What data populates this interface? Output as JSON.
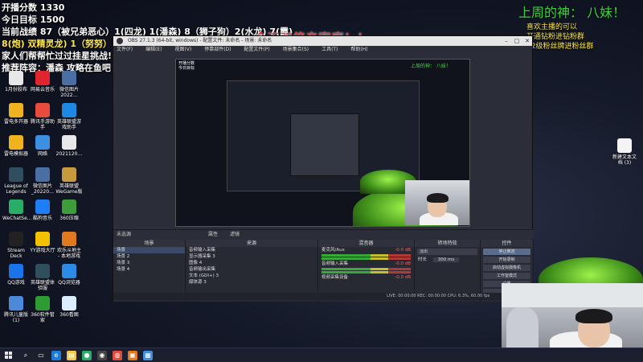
{
  "overlay": {
    "score_label": "开播分数",
    "score_value": "1330",
    "goal_label": "今日目标",
    "goal_value": "1500",
    "record_line": "当前战绩 87（被兄弟恶心）1(四龙) 1(潘森) 8（狮子狗）2(水龙) 7(霞)",
    "record_line2": "8(炮) 双精灵龙) 1（努努）(潘森) 3(凯) 1 (水枪)",
    "help_line": "家人们帮帮忙过过挂星挑战!",
    "lineup_line": "推荐阵容：潘森 攻略在鱼吧",
    "title": "今天双倍亲密度！！",
    "god_title": "上周的神： 八妹！",
    "fan_lines": [
      "喜欢主播的可以",
      "开通钻粉进钻粉群",
      "12级粉丝牌进粉丝群"
    ]
  },
  "desktop_icons_left": [
    {
      "label": "1月份胶布",
      "icon": "document-icon",
      "color": "#e8e8e8"
    },
    {
      "label": "网易云音乐",
      "icon": "netease-music-icon",
      "color": "#e0262c"
    },
    {
      "label": "微信图片 2022…",
      "icon": "image-icon",
      "color": "#4a6fa5"
    },
    {
      "label": "雷电多开器",
      "icon": "android-emulator-icon",
      "color": "#f0b21e"
    },
    {
      "label": "腾讯手游助手",
      "icon": "tencent-games-icon",
      "color": "#e94b3c"
    },
    {
      "label": "英雄联盟游戏助手",
      "icon": "lol-helper-icon",
      "color": "#1e88e5"
    },
    {
      "label": "雷电模拟器",
      "icon": "ldplayer-icon",
      "color": "#f0b21e"
    },
    {
      "label": "网络",
      "icon": "network-icon",
      "color": "#3d8fe0"
    },
    {
      "label": "2021120…",
      "icon": "document-icon",
      "color": "#e8e8e8"
    },
    {
      "label": "League of Legends",
      "icon": "lol-icon",
      "color": "#2f4f5f"
    },
    {
      "label": "微信图片_20220…",
      "icon": "image-icon",
      "color": "#4a6fa5"
    },
    {
      "label": "英雄联盟WeGame版",
      "icon": "wegame-icon",
      "color": "#c79b3b"
    },
    {
      "label": "WeChatSe…",
      "icon": "wechat-icon",
      "color": "#2aae67"
    },
    {
      "label": "酷狗音乐",
      "icon": "kugou-icon",
      "color": "#1f7ef5"
    },
    {
      "label": "360压缩",
      "icon": "archive-icon",
      "color": "#3f9c3a"
    },
    {
      "label": "Stream Deck",
      "icon": "stream-deck-icon",
      "color": "#222"
    },
    {
      "label": "YY游戏大厅",
      "icon": "yy-icon",
      "color": "#f2c200"
    },
    {
      "label": "欢乐斗地主 - 本地游戏",
      "icon": "doudizhu-icon",
      "color": "#e07a1f"
    },
    {
      "label": "QQ游戏",
      "icon": "qq-games-icon",
      "color": "#1a73e8"
    },
    {
      "label": "英雄联盟体验服",
      "icon": "lol-pbe-icon",
      "color": "#2f4f5f"
    },
    {
      "label": "QQ浏览器",
      "icon": "qq-browser-icon",
      "color": "#2b8be6"
    },
    {
      "label": "腾讯儿童版 (1)",
      "icon": "folder-icon",
      "color": "#4c89d9"
    },
    {
      "label": "360软件管家",
      "icon": "360-manager-icon",
      "color": "#2f9b34"
    },
    {
      "label": "360看图",
      "icon": "360-viewer-icon",
      "color": "#dbeeff"
    }
  ],
  "desktop_icons_right": [
    {
      "label": "新建文本文档 (3)",
      "icon": "text-file-icon",
      "color": "#f4f4f4"
    }
  ],
  "obs": {
    "window_title": "OBS 27.1.3 (64-bit, windows) - 配置文件: 未命名 - 场景: 未命名",
    "menu": [
      "文件(F)",
      "编辑(E)",
      "视图(V)",
      "停靠部件(D)",
      "配置文件(P)",
      "场景集合(S)",
      "工具(T)",
      "帮助(H)"
    ],
    "scene_bar_label": "未选源",
    "properties_button": "属性",
    "filters_button": "滤镜",
    "docks": {
      "scenes_title": "场景",
      "scenes": [
        "场景",
        "场景 2",
        "场景 3",
        "场景 4"
      ],
      "sources_title": "来源",
      "sources": [
        "音频输入采集",
        "显示器采集 3",
        "图像 4",
        "音频输出采集",
        "文本 (GDI+) 3",
        "媒体源 3"
      ],
      "mixer_title": "混音器",
      "mixer": [
        {
          "name": "麦克风/Aux",
          "db": "-0.0 dB"
        },
        {
          "name": "音频输入采集",
          "db": "-0.0 dB"
        },
        {
          "name": "视频采集设备",
          "db": "-0.0 dB"
        }
      ],
      "transitions_title": "转场特效",
      "transition_value": "淡出",
      "duration_label": "时长",
      "duration_value": "300 ms",
      "controls_title": "控件",
      "controls": [
        "停止推流",
        "开始录制",
        "启动虚拟摄像机",
        "工作室模式",
        "设置",
        "退出"
      ]
    },
    "status": "LIVE: 00:00:00  REC: 00:00:00  CPU: 6.3%, 60.00 fps"
  },
  "taskbar": {
    "icons": [
      "search-icon",
      "task-view-icon",
      "edge-icon",
      "file-explorer-icon",
      "wechat-icon",
      "obs-icon",
      "chrome-icon",
      "app-icon",
      "store-icon"
    ]
  }
}
